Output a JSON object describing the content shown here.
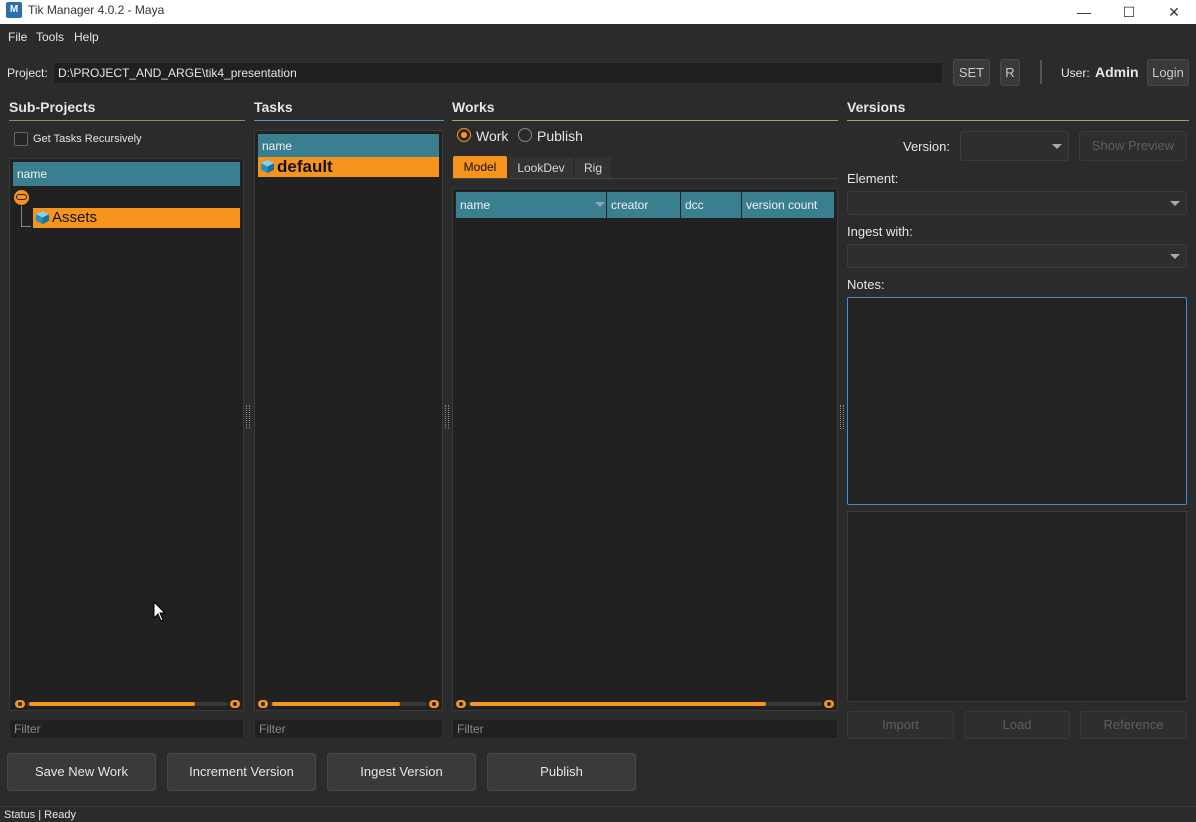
{
  "window": {
    "title": "Tik Manager 4.0.2 - Maya",
    "icon_letter": "M",
    "minimize": "—",
    "maximize": "☐",
    "close": "✕"
  },
  "menu": {
    "items": [
      "File",
      "Tools",
      "Help"
    ]
  },
  "project": {
    "label": "Project:",
    "path": "D:\\PROJECT_AND_ARGE\\tik4_presentation",
    "set_label": "SET",
    "r_label": "R",
    "user_label": "User:",
    "user_name": "Admin",
    "login_label": "Login"
  },
  "subprojects": {
    "title": "Sub-Projects",
    "recursive_label": "Get Tasks Recursively",
    "column": "name",
    "items": [
      {
        "label": "Assets",
        "selected": true
      }
    ],
    "filter_placeholder": "Filter"
  },
  "tasks": {
    "title": "Tasks",
    "column": "name",
    "items": [
      {
        "label": "default",
        "selected": true
      }
    ],
    "filter_placeholder": "Filter"
  },
  "works": {
    "title": "Works",
    "radio_work": "Work",
    "radio_publish": "Publish",
    "selected_mode": "Work",
    "tabs": [
      "Model",
      "LookDev",
      "Rig"
    ],
    "active_tab": "Model",
    "columns": [
      "name",
      "creator",
      "dcc",
      "version count"
    ],
    "rows": [],
    "filter_placeholder": "Filter"
  },
  "versions": {
    "title": "Versions",
    "version_label": "Version:",
    "version_value": "",
    "show_preview": "Show Preview",
    "element_label": "Element:",
    "ingest_label": "Ingest with:",
    "notes_label": "Notes:",
    "notes_value": "",
    "import_label": "Import",
    "load_label": "Load",
    "reference_label": "Reference"
  },
  "actions": {
    "save_new_work": "Save New Work",
    "increment_version": "Increment Version",
    "ingest_version": "Ingest Version",
    "publish": "Publish"
  },
  "status": {
    "text": "Status | Ready"
  },
  "colors": {
    "accent": "#f7941d",
    "header": "#3a7f90"
  }
}
